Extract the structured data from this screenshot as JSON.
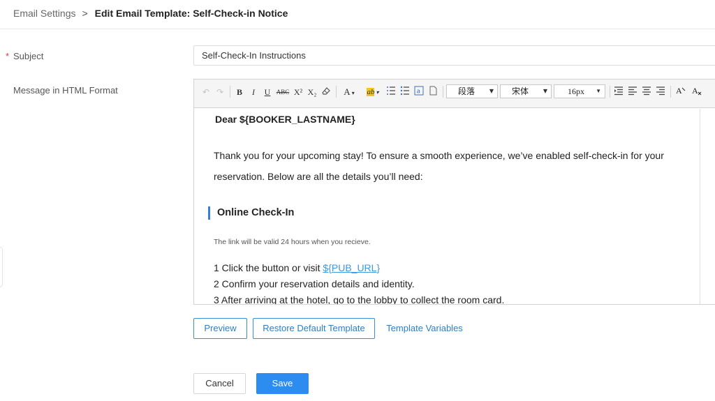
{
  "breadcrumb": {
    "root": "Email Settings",
    "separator": ">",
    "current": "Edit Email Template: Self-Check-in Notice"
  },
  "form": {
    "subject_label": "Subject",
    "required_mark": "*",
    "subject_value": "Self-Check-In Instructions",
    "message_label": "Message in HTML Format"
  },
  "toolbar": {
    "paragraph_select": "段落",
    "font_select": "宋体",
    "size_select": "16px",
    "bold": "B",
    "italic": "I",
    "underline": "U",
    "strikethrough": "ABC",
    "superscript": "X²",
    "subscript": "X₂",
    "font_color": "A",
    "highlight": "ab"
  },
  "editor": {
    "greeting": "Dear ${BOOKER_LASTNAME}",
    "intro": "Thank you for your upcoming stay! To ensure a smooth experience, we’ve enabled self-check-in for your reservation. Below are all the details you’ll need:",
    "section_title": "Online Check-In",
    "note": "The link will be valid 24 hours when you recieve.",
    "step1_prefix": "1 Click the button or visit ",
    "step1_link": "${PUB_URL}",
    "step2": "2 Confirm your reservation details and identity.",
    "step3": "3 After arriving at the hotel, go to the lobby to collect the room card."
  },
  "actions": {
    "preview": "Preview",
    "restore": "Restore Default Template",
    "variables": "Template Variables",
    "cancel": "Cancel",
    "save": "Save"
  },
  "colors": {
    "accent": "#2d8cf0",
    "link": "#3b9ae1",
    "required": "#e4393c"
  }
}
